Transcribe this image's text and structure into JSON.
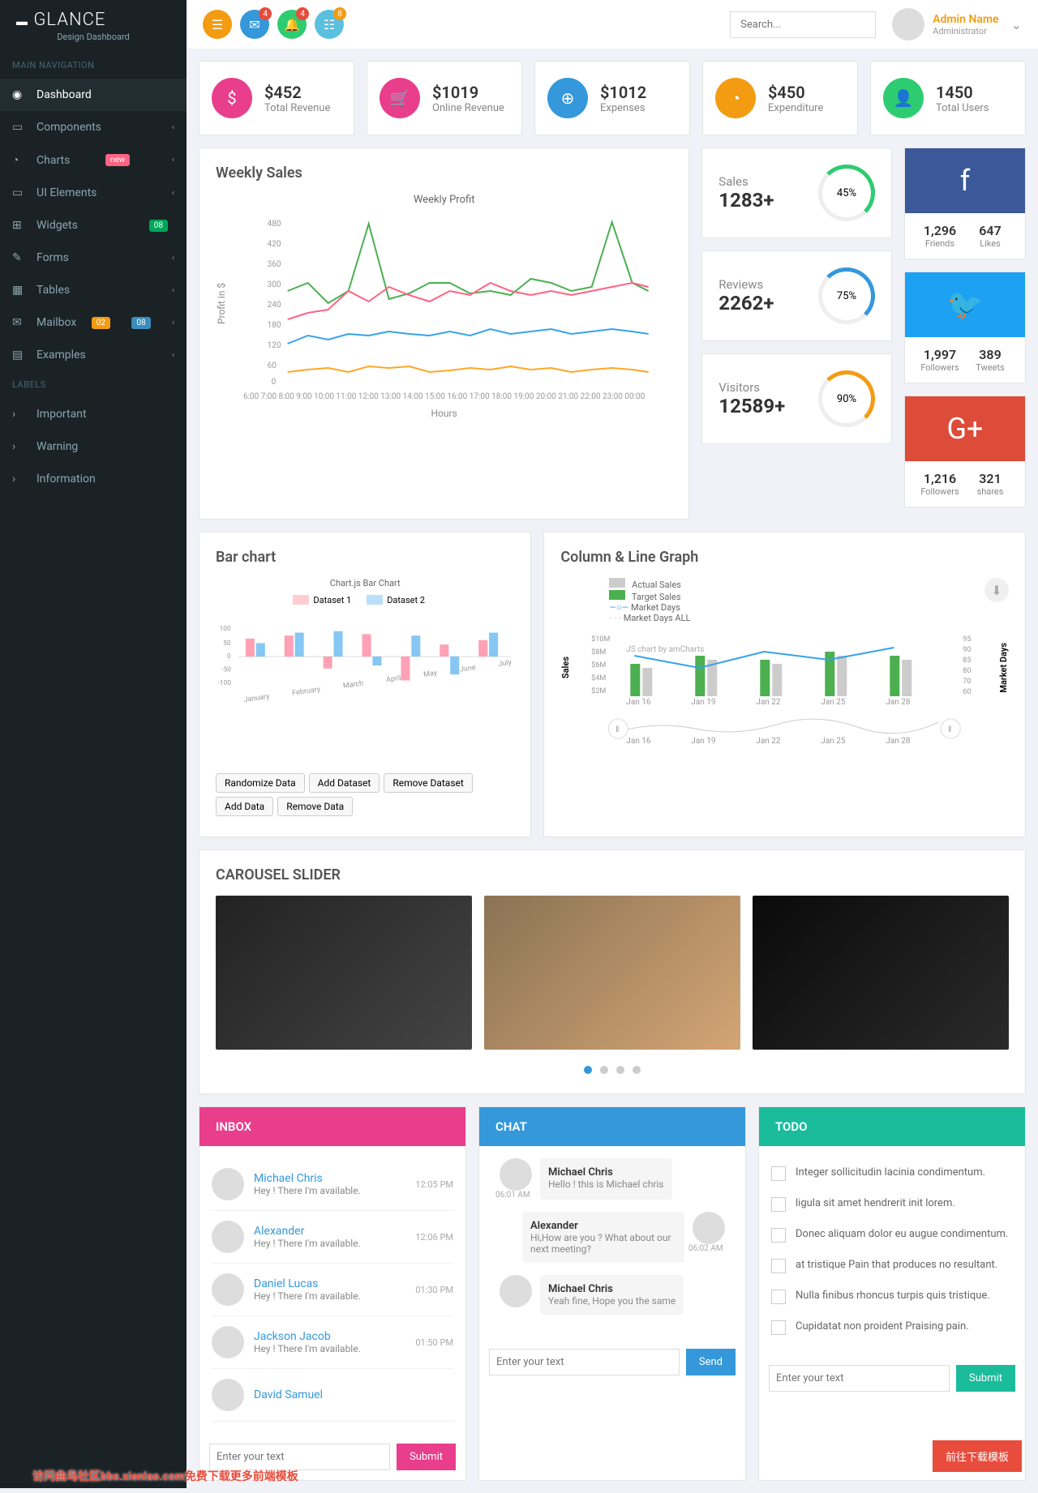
{
  "brand": {
    "title": "GLANCE",
    "subtitle": "Design Dashboard"
  },
  "nav_headers": {
    "main": "MAIN NAVIGATION",
    "labels": "LABELS"
  },
  "nav": [
    {
      "label": "Dashboard",
      "icon": "◉"
    },
    {
      "label": "Components",
      "icon": "▭",
      "chevron": true
    },
    {
      "label": "Charts",
      "icon": "◔",
      "badge": "new",
      "badge_class": "badge-pink",
      "chevron": true
    },
    {
      "label": "UI Elements",
      "icon": "▭",
      "chevron": true
    },
    {
      "label": "Widgets",
      "icon": "⊞",
      "badge": "08",
      "badge_class": "badge-green"
    },
    {
      "label": "Forms",
      "icon": "✎",
      "chevron": true
    },
    {
      "label": "Tables",
      "icon": "▦",
      "chevron": true
    },
    {
      "label": "Mailbox",
      "icon": "✉",
      "badge": "02",
      "badge_class": "badge-orange",
      "badge2": "08",
      "badge2_class": "badge-blue",
      "chevron": true
    },
    {
      "label": "Examples",
      "icon": "▤",
      "chevron": true
    }
  ],
  "labels_nav": [
    {
      "label": "Important"
    },
    {
      "label": "Warning"
    },
    {
      "label": "Information"
    }
  ],
  "topbar": {
    "badges": {
      "mail": "4",
      "bell": "4",
      "task": "8"
    },
    "search_placeholder": "Search...",
    "user_name": "Admin Name",
    "user_role": "Administrator"
  },
  "stats": [
    {
      "value": "$452",
      "label": "Total Revenue",
      "color": "#e83e8c",
      "icon": "$"
    },
    {
      "value": "$1019",
      "label": "Online Revenue",
      "color": "#e83e8c",
      "icon": "🛒"
    },
    {
      "value": "$1012",
      "label": "Expenses",
      "color": "#3498db",
      "icon": "⊕"
    },
    {
      "value": "$450",
      "label": "Expenditure",
      "color": "#f39c12",
      "icon": "◔"
    },
    {
      "value": "1450",
      "label": "Total Users",
      "color": "#2ecc71",
      "icon": "👤"
    }
  ],
  "weekly": {
    "title": "Weekly Sales",
    "chart_title": "Weekly Profit",
    "xlabel": "Hours",
    "ylabel": "Profit in $"
  },
  "mini_stats": [
    {
      "label": "Sales",
      "value": "1283+",
      "pct": "45%",
      "color": "#2ecc71"
    },
    {
      "label": "Reviews",
      "value": "2262+",
      "pct": "75%",
      "color": "#3498db"
    },
    {
      "label": "Visitors",
      "value": "12589+",
      "pct": "90%",
      "color": "#f39c12"
    }
  ],
  "social": [
    {
      "color": "#3b5998",
      "icon": "f",
      "n1": "1,296",
      "l1": "Friends",
      "n2": "647",
      "l2": "Likes"
    },
    {
      "color": "#1da1f2",
      "icon": "🐦",
      "n1": "1,997",
      "l1": "Followers",
      "n2": "389",
      "l2": "Tweets"
    },
    {
      "color": "#dd4b39",
      "icon": "G+",
      "n1": "1,216",
      "l1": "Followers",
      "n2": "321",
      "l2": "shares"
    }
  ],
  "bar_chart": {
    "title": "Bar chart",
    "chart_title": "Chart.js Bar Chart",
    "legend": [
      "Dataset 1",
      "Dataset 2"
    ],
    "buttons": [
      "Randomize Data",
      "Add Dataset",
      "Remove Dataset",
      "Add Data",
      "Remove Data"
    ]
  },
  "column_chart": {
    "title": "Column & Line Graph",
    "legend": [
      "Actual Sales",
      "Target Sales",
      "Market Days",
      "Market Days ALL"
    ],
    "ylabel_left": "Sales",
    "ylabel_right": "Market Days",
    "credit": "JS chart by amCharts"
  },
  "carousel": {
    "title": "CAROUSEL SLIDER"
  },
  "inbox": {
    "title": "INBOX",
    "items": [
      {
        "name": "Michael Chris",
        "msg": "Hey ! There I'm available.",
        "time": "12:05 PM"
      },
      {
        "name": "Alexander",
        "msg": "Hey ! There I'm available.",
        "time": "12:06 PM"
      },
      {
        "name": "Daniel Lucas",
        "msg": "Hey ! There I'm available.",
        "time": "01:30 PM"
      },
      {
        "name": "Jackson Jacob",
        "msg": "Hey ! There I'm available.",
        "time": "01:50 PM"
      },
      {
        "name": "David Samuel",
        "msg": "",
        "time": ""
      }
    ],
    "placeholder": "Enter your text",
    "button": "Submit"
  },
  "chat": {
    "title": "CHAT",
    "msgs": [
      {
        "name": "Michael Chris",
        "text": "Hello ! this is Michael chris",
        "time": "06:01 AM",
        "side": "left"
      },
      {
        "name": "Alexander",
        "text": "Hi,How are you ? What about our next meeting?",
        "time": "06:02 AM",
        "side": "right"
      },
      {
        "name": "Michael Chris",
        "text": "Yeah fine, Hope you the same",
        "time": "",
        "side": "left"
      }
    ],
    "placeholder": "Enter your text",
    "button": "Send"
  },
  "todo": {
    "title": "TODO",
    "items": [
      "Integer sollicitudin lacinia condimentum.",
      "ligula sit amet hendrerit init lorem.",
      "Donec aliquam dolor eu augue condimentum.",
      "at tristique Pain that produces no resultant.",
      "Nulla finibus rhoncus turpis quis tristique.",
      "Cupidatat non proident Praising pain."
    ],
    "placeholder": "Enter your text",
    "button": "Submit"
  },
  "float_btn": "前往下载模板",
  "watermark": "访问曲鸟社区bbs.xienlao.com免费下载更多前端模板",
  "chart_data": [
    {
      "type": "line",
      "title": "Weekly Profit",
      "xlabel": "Hours",
      "ylabel": "Profit in $",
      "ylim": [
        0,
        480
      ],
      "x": [
        "6:00",
        "7:00",
        "8:00",
        "9:00",
        "10:00",
        "11:00",
        "12:00",
        "13:00",
        "14:00",
        "15:00",
        "16:00",
        "17:00",
        "18:00",
        "19:00",
        "20:00",
        "21:00",
        "22:00",
        "23:00",
        "00:00"
      ],
      "series": [
        {
          "name": "Green",
          "color": "#4caf50",
          "values": [
            280,
            300,
            240,
            280,
            470,
            250,
            270,
            300,
            300,
            270,
            280,
            260,
            310,
            300,
            280,
            290,
            480,
            300,
            280
          ]
        },
        {
          "name": "Pink",
          "color": "#ff6384",
          "values": [
            200,
            220,
            230,
            280,
            250,
            290,
            260,
            250,
            280,
            260,
            300,
            280,
            270,
            280,
            260,
            280,
            290,
            300,
            290
          ]
        },
        {
          "name": "Blue",
          "color": "#36a2eb",
          "values": [
            120,
            150,
            140,
            160,
            150,
            170,
            160,
            150,
            170,
            160,
            180,
            160,
            170,
            180,
            160,
            170,
            180,
            170,
            160
          ]
        },
        {
          "name": "Orange",
          "color": "#ffa726",
          "values": [
            40,
            45,
            50,
            40,
            60,
            50,
            55,
            45,
            42,
            50,
            48,
            55,
            45,
            50,
            40,
            45,
            50,
            45,
            40
          ]
        }
      ]
    },
    {
      "type": "bar",
      "title": "Chart.js Bar Chart",
      "categories": [
        "January",
        "February",
        "March",
        "April",
        "May",
        "June",
        "July"
      ],
      "ylim": [
        -100,
        100
      ],
      "series": [
        {
          "name": "Dataset 1",
          "color": "#ff6384",
          "values": [
            60,
            70,
            -40,
            75,
            -80,
            40,
            55
          ]
        },
        {
          "name": "Dataset 2",
          "color": "#36a2eb",
          "values": [
            45,
            80,
            85,
            -30,
            70,
            -60,
            80
          ]
        }
      ]
    },
    {
      "type": "bar",
      "title": "Column & Line Graph",
      "categories": [
        "Jan 16",
        "Jan 19",
        "Jan 22",
        "Jan 25",
        "Jan 28"
      ],
      "ylabel": "Sales",
      "ylim_left": [
        "$2M",
        "$4M",
        "$6M",
        "$8M",
        "$10M"
      ],
      "ylim_right": [
        60,
        70,
        80,
        85,
        90,
        95
      ],
      "series": [
        {
          "name": "Actual Sales",
          "type": "bar",
          "color": "#cccccc",
          "values": [
            5,
            7,
            6,
            8,
            7
          ]
        },
        {
          "name": "Target Sales",
          "type": "bar",
          "color": "#4caf50",
          "values": [
            6,
            8,
            7,
            9,
            8
          ]
        },
        {
          "name": "Market Days",
          "type": "line",
          "color": "#36a2eb",
          "values": [
            80,
            70,
            85,
            80,
            90
          ]
        },
        {
          "name": "Market Days ALL",
          "type": "line",
          "color": "#cccccc",
          "values": [
            75,
            78,
            72,
            80,
            78
          ]
        }
      ]
    }
  ]
}
